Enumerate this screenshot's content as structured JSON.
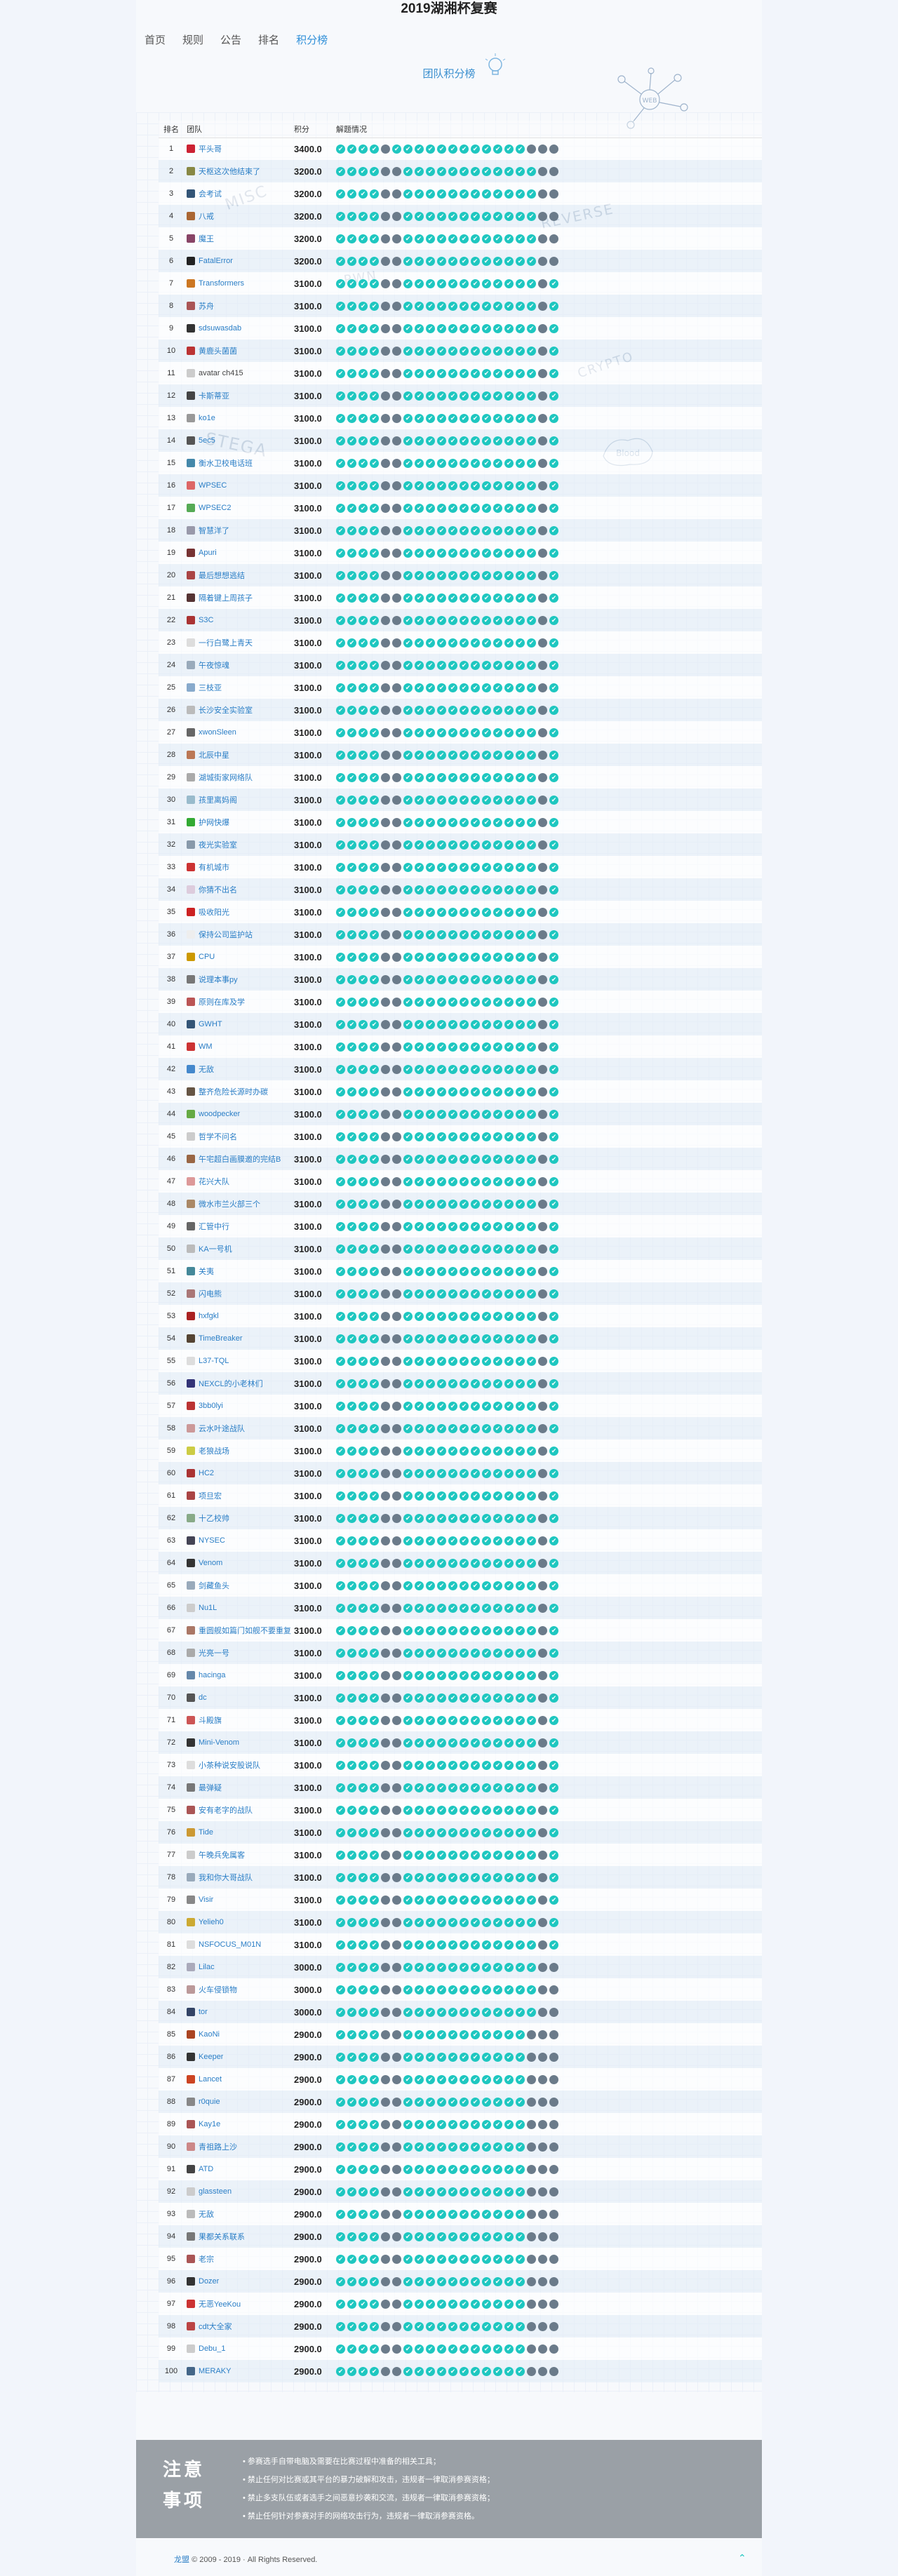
{
  "site": {
    "title": "2019湖湘杯复赛"
  },
  "nav": [
    {
      "label": "首页",
      "active": false
    },
    {
      "label": "规则",
      "active": false
    },
    {
      "label": "公告",
      "active": false
    },
    {
      "label": "排名",
      "active": false
    },
    {
      "label": "积分榜",
      "active": true
    }
  ],
  "board": {
    "title": "团队积分榜",
    "headers": {
      "rank": "排名",
      "team": "团队",
      "score": "积分",
      "progress": "解题情况"
    }
  },
  "decor": {
    "words": [
      "MISC",
      "REVERSE",
      "CRYPTO",
      "STEGA",
      "PWN"
    ],
    "badges": [
      "WEB",
      "Blood"
    ]
  },
  "teams": [
    {
      "rank": "1",
      "name": "平头哥",
      "score": "3400.0",
      "c": "#c23"
    },
    {
      "rank": "2",
      "name": "天枢这次他结束了",
      "score": "3200.0",
      "c": "#884"
    },
    {
      "rank": "3",
      "name": "会考试",
      "score": "3200.0",
      "c": "#357"
    },
    {
      "rank": "4",
      "name": "八戒",
      "score": "3200.0",
      "c": "#a63"
    },
    {
      "rank": "5",
      "name": "魔王",
      "score": "3200.0",
      "c": "#846"
    },
    {
      "rank": "6",
      "name": "FatalError",
      "score": "3200.0",
      "c": "#222"
    },
    {
      "rank": "7",
      "name": "Transformers",
      "score": "3100.0",
      "c": "#c72"
    },
    {
      "rank": "8",
      "name": "苏舟",
      "score": "3100.0",
      "c": "#a55"
    },
    {
      "rank": "9",
      "name": "sdsuwasdab",
      "score": "3100.0",
      "c": "#333"
    },
    {
      "rank": "10",
      "name": "黄鹿头菌菌",
      "score": "3100.0",
      "c": "#b33"
    },
    {
      "rank": "11",
      "name": "avatar ch415",
      "score": "3100.0",
      "c": "#ccc",
      "broken": true
    },
    {
      "rank": "12",
      "name": "卡斯蒂亚",
      "score": "3100.0",
      "c": "#444"
    },
    {
      "rank": "13",
      "name": "ko1e",
      "score": "3100.0",
      "c": "#999"
    },
    {
      "rank": "14",
      "name": "5ec5",
      "score": "3100.0",
      "c": "#555"
    },
    {
      "rank": "15",
      "name": "衡水卫校电话班",
      "score": "3100.0",
      "c": "#48a"
    },
    {
      "rank": "16",
      "name": "WPSEC",
      "score": "3100.0",
      "c": "#d66"
    },
    {
      "rank": "17",
      "name": "WPSEC2",
      "score": "3100.0",
      "c": "#5a5"
    },
    {
      "rank": "18",
      "name": "智慧洋了",
      "score": "3100.0",
      "c": "#99a"
    },
    {
      "rank": "19",
      "name": "Apuri",
      "score": "3100.0",
      "c": "#733"
    },
    {
      "rank": "20",
      "name": "最后想想逃结",
      "score": "3100.0",
      "c": "#a44"
    },
    {
      "rank": "21",
      "name": "隔着键上周孩子",
      "score": "3100.0",
      "c": "#533"
    },
    {
      "rank": "22",
      "name": "S3C",
      "score": "3100.0",
      "c": "#a33"
    },
    {
      "rank": "23",
      "name": "一行白鹭上青天",
      "score": "3100.0",
      "c": "#ddd"
    },
    {
      "rank": "24",
      "name": "午夜惊魂",
      "score": "3100.0",
      "c": "#9ab"
    },
    {
      "rank": "25",
      "name": "三枝亚",
      "score": "3100.0",
      "c": "#8ac"
    },
    {
      "rank": "26",
      "name": "长沙安全实验室",
      "score": "3100.0",
      "c": "#bbb"
    },
    {
      "rank": "27",
      "name": "xwonSleen",
      "score": "3100.0",
      "c": "#666"
    },
    {
      "rank": "28",
      "name": "北辰中星",
      "score": "3100.0",
      "c": "#b75"
    },
    {
      "rank": "29",
      "name": "湖城街家网络队",
      "score": "3100.0",
      "c": "#aaa"
    },
    {
      "rank": "30",
      "name": "孩里离妈阁",
      "score": "3100.0",
      "c": "#9bc"
    },
    {
      "rank": "31",
      "name": "护网快爆",
      "score": "3100.0",
      "c": "#3a3"
    },
    {
      "rank": "32",
      "name": "夜光实验室",
      "score": "3100.0",
      "c": "#89a"
    },
    {
      "rank": "33",
      "name": "有机城市",
      "score": "3100.0",
      "c": "#c33"
    },
    {
      "rank": "34",
      "name": "你猜不出名",
      "score": "3100.0",
      "c": "#dcd"
    },
    {
      "rank": "35",
      "name": "吸收阳光",
      "score": "3100.0",
      "c": "#c22"
    },
    {
      "rank": "36",
      "name": "保持公司监护站",
      "score": "3100.0",
      "c": "#eee"
    },
    {
      "rank": "37",
      "name": "CPU",
      "score": "3100.0",
      "c": "#c90"
    },
    {
      "rank": "38",
      "name": "说理本事py",
      "score": "3100.0",
      "c": "#777"
    },
    {
      "rank": "39",
      "name": "原则在库及学",
      "score": "3100.0",
      "c": "#b55"
    },
    {
      "rank": "40",
      "name": "GWHT",
      "score": "3100.0",
      "c": "#357"
    },
    {
      "rank": "41",
      "name": "WM",
      "score": "3100.0",
      "c": "#c33"
    },
    {
      "rank": "42",
      "name": "无敌",
      "score": "3100.0",
      "c": "#48c"
    },
    {
      "rank": "43",
      "name": "整齐危险长源时办碳",
      "score": "3100.0",
      "c": "#654"
    },
    {
      "rank": "44",
      "name": "woodpecker",
      "score": "3100.0",
      "c": "#6a4"
    },
    {
      "rank": "45",
      "name": "哲学不问名",
      "score": "3100.0",
      "c": "#ccc"
    },
    {
      "rank": "46",
      "name": "午宅超白画膜邀的完结B",
      "score": "3100.0",
      "c": "#964"
    },
    {
      "rank": "47",
      "name": "花兴大队",
      "score": "3100.0",
      "c": "#d99"
    },
    {
      "rank": "48",
      "name": "微水市兰火部三个",
      "score": "3100.0",
      "c": "#a86"
    },
    {
      "rank": "49",
      "name": "汇管中行",
      "score": "3100.0",
      "c": "#666"
    },
    {
      "rank": "50",
      "name": "KA一号机",
      "score": "3100.0",
      "c": "#bbb"
    },
    {
      "rank": "51",
      "name": "关夷",
      "score": "3100.0",
      "c": "#489"
    },
    {
      "rank": "52",
      "name": "闪电熊",
      "score": "3100.0",
      "c": "#a77"
    },
    {
      "rank": "53",
      "name": "hxfgkl",
      "score": "3100.0",
      "c": "#a22"
    },
    {
      "rank": "54",
      "name": "TimeBreaker",
      "score": "3100.0",
      "c": "#543"
    },
    {
      "rank": "55",
      "name": "L37-TQL",
      "score": "3100.0",
      "c": "#ddd"
    },
    {
      "rank": "56",
      "name": "NEXCL的小老林们",
      "score": "3100.0",
      "c": "#337"
    },
    {
      "rank": "57",
      "name": "3bb0lyi",
      "score": "3100.0",
      "c": "#b33"
    },
    {
      "rank": "58",
      "name": "云水叶途战队",
      "score": "3100.0",
      "c": "#c99"
    },
    {
      "rank": "59",
      "name": "老狼战场",
      "score": "3100.0",
      "c": "#cc4"
    },
    {
      "rank": "60",
      "name": "HC2",
      "score": "3100.0",
      "c": "#a33"
    },
    {
      "rank": "61",
      "name": "项旦宏",
      "score": "3100.0",
      "c": "#a44"
    },
    {
      "rank": "62",
      "name": "十乙校帅",
      "score": "3100.0",
      "c": "#8a8"
    },
    {
      "rank": "63",
      "name": "NYSEC",
      "score": "3100.0",
      "c": "#445"
    },
    {
      "rank": "64",
      "name": "Venom",
      "score": "3100.0",
      "c": "#333"
    },
    {
      "rank": "65",
      "name": "剑藏鱼头",
      "score": "3100.0",
      "c": "#9ab"
    },
    {
      "rank": "66",
      "name": "Nu1L",
      "score": "3100.0",
      "c": "#ccc"
    },
    {
      "rank": "67",
      "name": "重圆舰如篇门如舰不要重复",
      "score": "3100.0",
      "c": "#a76"
    },
    {
      "rank": "68",
      "name": "光亮一号",
      "score": "3100.0",
      "c": "#aaa"
    },
    {
      "rank": "69",
      "name": "hacinga",
      "score": "3100.0",
      "c": "#68a"
    },
    {
      "rank": "70",
      "name": "dc",
      "score": "3100.0",
      "c": "#555"
    },
    {
      "rank": "71",
      "name": "斗殿旗",
      "score": "3100.0",
      "c": "#c55"
    },
    {
      "rank": "72",
      "name": "Mini-Venom",
      "score": "3100.0",
      "c": "#333"
    },
    {
      "rank": "73",
      "name": "小茶种说安股说队",
      "score": "3100.0",
      "c": "#ddd"
    },
    {
      "rank": "74",
      "name": "最弹疑",
      "score": "3100.0",
      "c": "#777"
    },
    {
      "rank": "75",
      "name": "安有老字的战队",
      "score": "3100.0",
      "c": "#a55"
    },
    {
      "rank": "76",
      "name": "Tide",
      "score": "3100.0",
      "c": "#c93"
    },
    {
      "rank": "77",
      "name": "午晚兵免属客",
      "score": "3100.0",
      "c": "#ccc"
    },
    {
      "rank": "78",
      "name": "我和你大哥战队",
      "score": "3100.0",
      "c": "#9ab"
    },
    {
      "rank": "79",
      "name": "Visir",
      "score": "3100.0",
      "c": "#888"
    },
    {
      "rank": "80",
      "name": "Yelieh0",
      "score": "3100.0",
      "c": "#ca3"
    },
    {
      "rank": "81",
      "name": "NSFOCUS_M01N",
      "score": "3100.0",
      "c": "#ddd"
    },
    {
      "rank": "82",
      "name": "Lilac",
      "score": "3000.0",
      "c": "#aab"
    },
    {
      "rank": "83",
      "name": "火车侵锁物",
      "score": "3000.0",
      "c": "#b99"
    },
    {
      "rank": "84",
      "name": "tor",
      "score": "3000.0",
      "c": "#346"
    },
    {
      "rank": "85",
      "name": "KaoNi",
      "score": "2900.0",
      "c": "#a42"
    },
    {
      "rank": "86",
      "name": "Keeper",
      "score": "2900.0",
      "c": "#333"
    },
    {
      "rank": "87",
      "name": "Lancet",
      "score": "2900.0",
      "c": "#c42"
    },
    {
      "rank": "88",
      "name": "r0quie",
      "score": "2900.0",
      "c": "#888"
    },
    {
      "rank": "89",
      "name": "Kay1e",
      "score": "2900.0",
      "c": "#a55"
    },
    {
      "rank": "90",
      "name": "青祖路上沙",
      "score": "2900.0",
      "c": "#c88"
    },
    {
      "rank": "91",
      "name": "ATD",
      "score": "2900.0",
      "c": "#444"
    },
    {
      "rank": "92",
      "name": "glassteen",
      "score": "2900.0",
      "c": "#ccc"
    },
    {
      "rank": "93",
      "name": "无敌",
      "score": "2900.0",
      "c": "#bbb"
    },
    {
      "rank": "94",
      "name": "果都关系联系",
      "score": "2900.0",
      "c": "#777"
    },
    {
      "rank": "95",
      "name": "老宗",
      "score": "2900.0",
      "c": "#a55"
    },
    {
      "rank": "96",
      "name": "Dozer",
      "score": "2900.0",
      "c": "#333"
    },
    {
      "rank": "97",
      "name": "无恶YeeKou",
      "score": "2900.0",
      "c": "#c33"
    },
    {
      "rank": "98",
      "name": "cdt大全家",
      "score": "2900.0",
      "c": "#b44"
    },
    {
      "rank": "99",
      "name": "Debu_1",
      "score": "2900.0",
      "c": "#ccc"
    },
    {
      "rank": "100",
      "name": "MERAKY",
      "score": "2900.0",
      "c": "#468"
    }
  ],
  "notice": {
    "title": "注意事项",
    "items": [
      "参赛选手自带电脑及需要在比赛过程中准备的相关工具；",
      "禁止任何对比赛或其平台的暴力破解和攻击，违规者一律取消参赛资格；",
      "禁止多支队伍或者选手之间恶意抄袭和交流，违规者一律取消参赛资格；",
      "禁止任何针对参赛对手的网络攻击行为，违规者一律取消参赛资格。"
    ]
  },
  "footer": {
    "brand": "龙盟",
    "text": "© 2009 - 2019 · All Rights Reserved."
  }
}
